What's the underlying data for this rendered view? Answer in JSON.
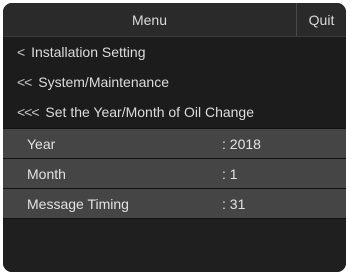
{
  "header": {
    "title": "Menu",
    "quit_label": "Quit"
  },
  "breadcrumbs": [
    {
      "chevron": "<",
      "label": "Installation Setting"
    },
    {
      "chevron": "<<",
      "label": "System/Maintenance"
    },
    {
      "chevron": "<<<",
      "label": "Set the Year/Month of Oil Change"
    }
  ],
  "settings": [
    {
      "label": "Year",
      "value": ": 2018"
    },
    {
      "label": "Month",
      "value": ": 1"
    },
    {
      "label": "Message Timing",
      "value": ": 31"
    }
  ],
  "colors": {
    "screen_bg": "#111111",
    "header_bg": "#2a2a2a",
    "row_bg": "#454545",
    "text": "#e2e2e2"
  }
}
